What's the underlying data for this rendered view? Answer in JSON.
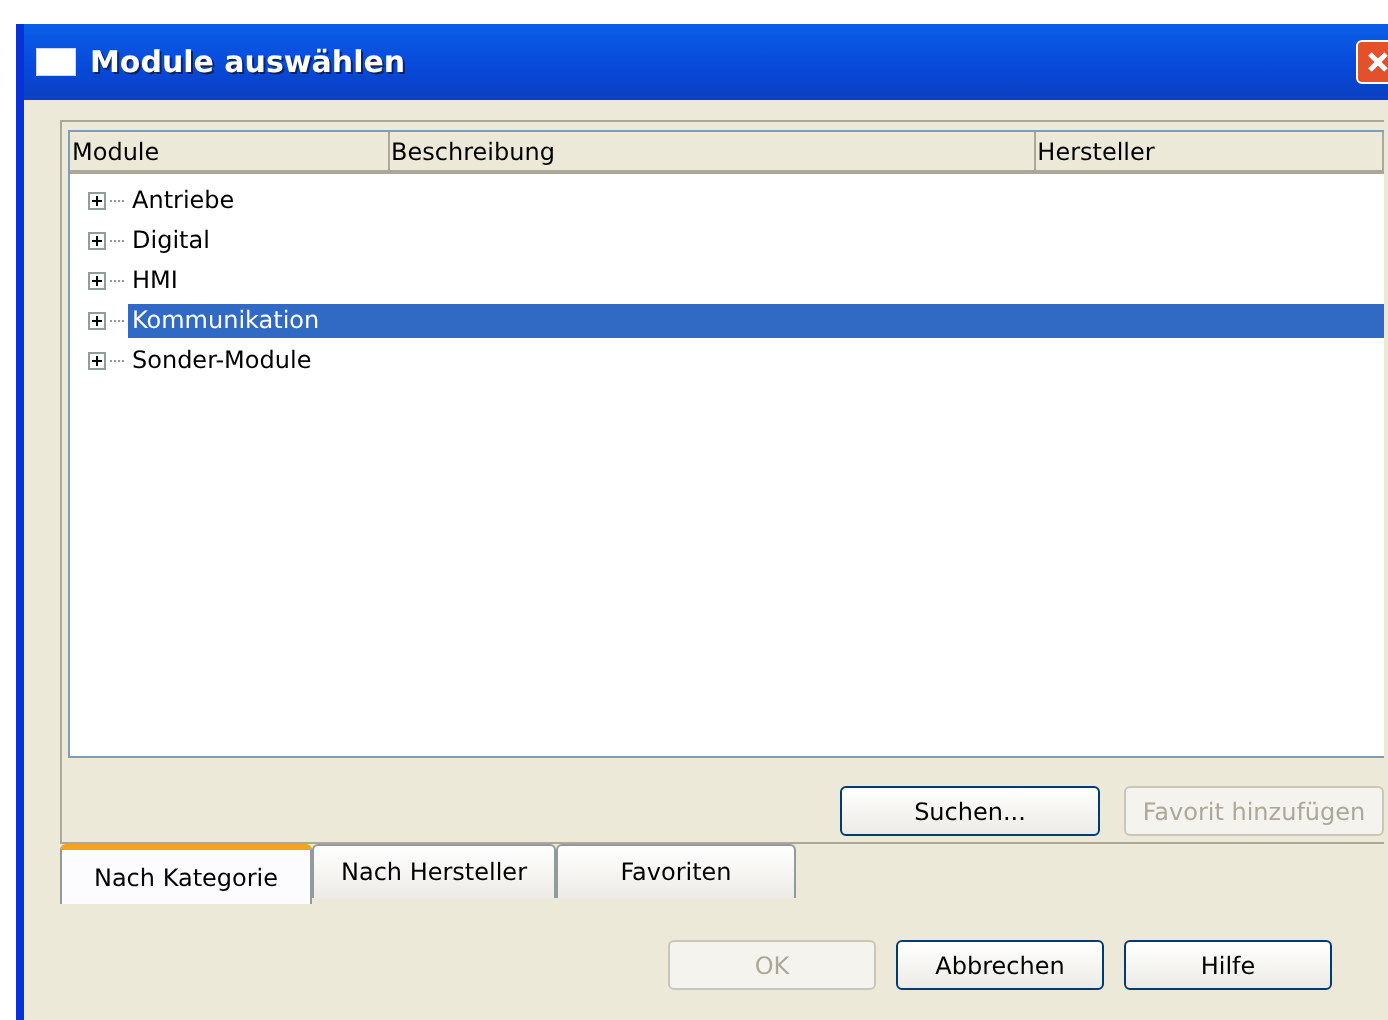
{
  "window": {
    "title": "Module auswählen"
  },
  "tree": {
    "columns": [
      "Module",
      "Beschreibung",
      "Hersteller"
    ],
    "items": [
      {
        "label": "Antriebe",
        "expanded": false,
        "selected": false
      },
      {
        "label": "Digital",
        "expanded": false,
        "selected": false
      },
      {
        "label": "HMI",
        "expanded": false,
        "selected": false
      },
      {
        "label": "Kommunikation",
        "expanded": false,
        "selected": true
      },
      {
        "label": "Sonder-Module",
        "expanded": false,
        "selected": false
      }
    ]
  },
  "panel_buttons": [
    {
      "label": "Suchen...",
      "disabled": false
    },
    {
      "label": "Favorit hinzufügen",
      "disabled": true
    }
  ],
  "tabs": [
    {
      "label": "Nach Kategorie",
      "selected": true
    },
    {
      "label": "Nach Hersteller",
      "selected": false
    },
    {
      "label": "Favoriten",
      "selected": false
    }
  ],
  "buttons": [
    {
      "label": "OK",
      "disabled": true
    },
    {
      "label": "Abbrechen",
      "disabled": false
    },
    {
      "label": "Hilfe",
      "disabled": false
    }
  ]
}
